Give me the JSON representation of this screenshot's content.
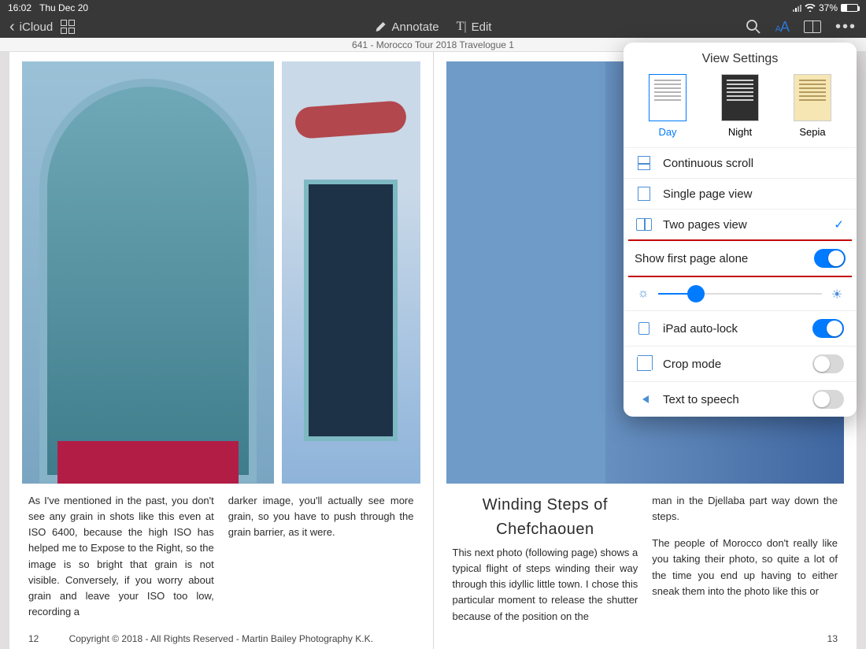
{
  "status": {
    "time": "16:02",
    "date": "Thu Dec 20",
    "battery": "37%"
  },
  "toolbar": {
    "back": "iCloud",
    "annotate": "Annotate",
    "edit": "Edit"
  },
  "doc_title": "641 - Morocco Tour 2018 Travelogue 1",
  "popover": {
    "title": "View Settings",
    "themes": {
      "day": "Day",
      "night": "Night",
      "sepia": "Sepia"
    },
    "continuous": "Continuous scroll",
    "single": "Single page view",
    "two": "Two pages view",
    "first_alone": "Show first page alone",
    "autolock": "iPad auto-lock",
    "crop": "Crop mode",
    "tts": "Text to speech"
  },
  "page_left": {
    "col1": "As I've mentioned in the past, you don't see any grain in shots like this even at ISO 6400, because the high ISO has helped me to Expose to the Right, so the image is so bright that grain is not visible. Conversely, if you worry about grain and leave your ISO too low, recording a",
    "col2": "darker image, you'll actually see more grain, so you have to push through the grain barrier, as it were.",
    "num": "12"
  },
  "page_right": {
    "heading": "Winding Steps of Chefchaouen",
    "col1": "This next photo (following page) shows a typical flight of steps winding their way through this idyllic little town. I chose this particular moment to release the shutter because of the position on the",
    "col2a": "man in the Djellaba part way down the steps.",
    "col2b": "The people of Morocco don't really like you taking their photo, so quite a lot of the time you end up having to either sneak them into the photo like this or",
    "num": "13"
  },
  "copyright": "Copyright © 2018 - All Rights Reserved - Martin Bailey Photography K.K."
}
